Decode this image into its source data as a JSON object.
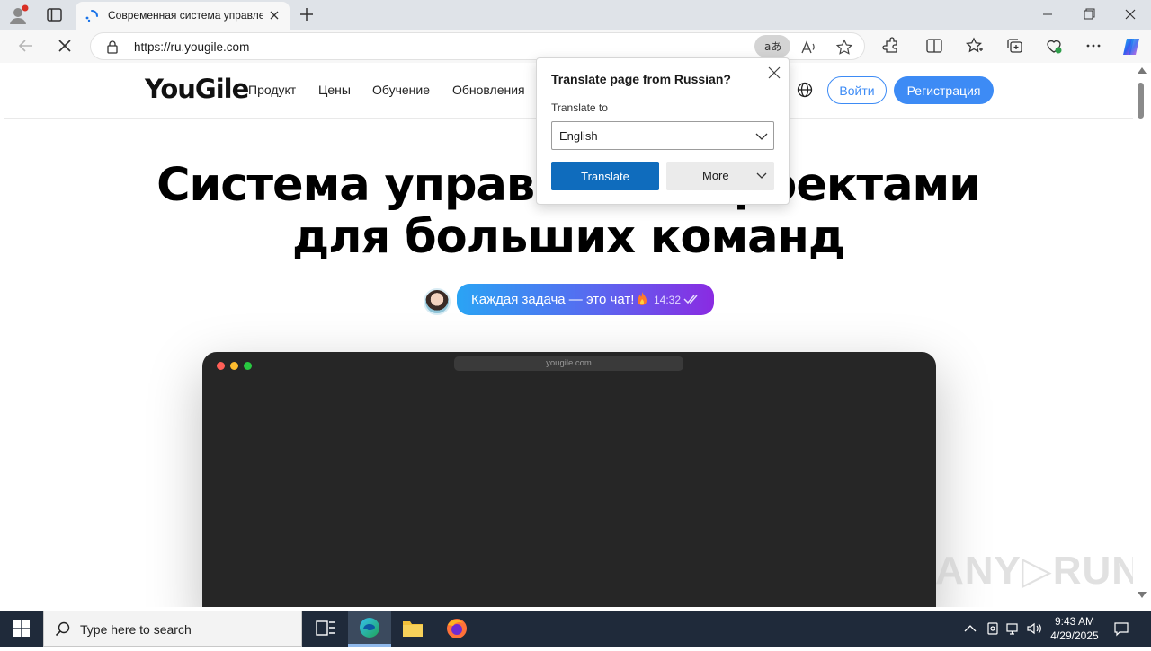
{
  "browser": {
    "tab_title": "Современная система управления",
    "url": "https://ru.yougile.com"
  },
  "site": {
    "logo": "YouGile",
    "nav": [
      "Продукт",
      "Цены",
      "Обучение",
      "Обновления"
    ],
    "login": "Войти",
    "signup": "Регистрация",
    "hero_line1": "Система управления проектами",
    "hero_line2": "для больших команд",
    "chat_text": "Каждая задача — это чат!",
    "chat_time": "14:32",
    "mock_url": "yougile.com",
    "watermark": "ANY▷RUN"
  },
  "translate_popup": {
    "title": "Translate page from Russian?",
    "label": "Translate to",
    "selected_language": "English",
    "translate_button": "Translate",
    "more_button": "More"
  },
  "taskbar": {
    "search_placeholder": "Type here to search",
    "time": "9:43 AM",
    "date": "4/29/2025"
  },
  "colors": {
    "accent": "#3d8bf5",
    "translate_button": "#0f6cbd",
    "taskbar": "#1f2a3a"
  }
}
